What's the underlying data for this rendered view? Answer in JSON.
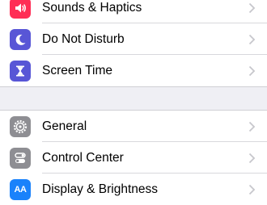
{
  "settings": {
    "group1": [
      {
        "label": "Sounds & Haptics",
        "icon": "speaker-icon",
        "color": "#ff2d55"
      },
      {
        "label": "Do Not Disturb",
        "icon": "moon-icon",
        "color": "#5856d6"
      },
      {
        "label": "Screen Time",
        "icon": "hourglass-icon",
        "color": "#5856d6"
      }
    ],
    "group2": [
      {
        "label": "General",
        "icon": "gear-icon",
        "color": "#8e8e93"
      },
      {
        "label": "Control Center",
        "icon": "toggles-icon",
        "color": "#8e8e93"
      },
      {
        "label": "Display & Brightness",
        "icon": "text-size-icon",
        "color": "#1a82fb",
        "icon_text": "AA"
      }
    ]
  },
  "colors": {
    "background": "#efeff4",
    "chevron": "#c7c7cc"
  }
}
